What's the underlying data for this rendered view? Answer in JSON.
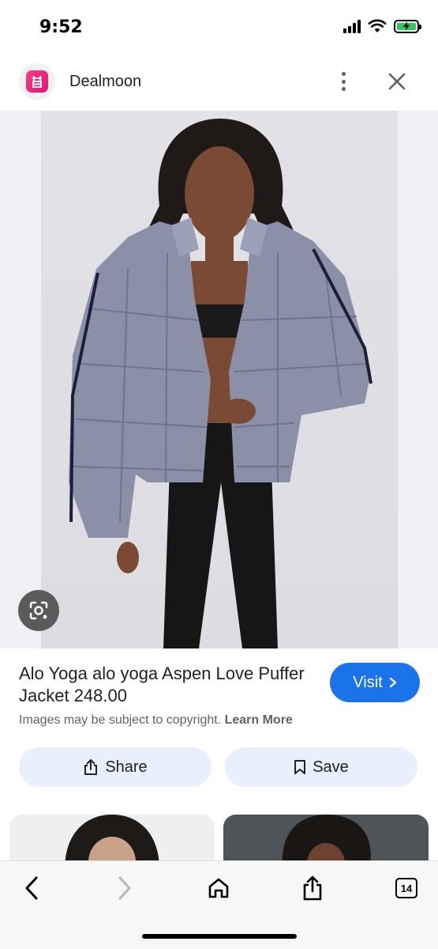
{
  "status_bar": {
    "time": "9:52"
  },
  "header": {
    "site_name": "Dealmoon",
    "logo_icon": "dealmoon-logo-icon",
    "logo_color": "#e0137b"
  },
  "product": {
    "title": "Alo Yoga alo yoga Aspen Love Puffer Jacket 248.00",
    "visit_label": "Visit",
    "copyright_text": "Images may be subject to copyright.",
    "learn_more_label": "Learn More"
  },
  "actions": {
    "share_label": "Share",
    "save_label": "Save"
  },
  "toolbar": {
    "tab_count": "14"
  },
  "colors": {
    "accent": "#1a73e8",
    "action_bg": "#e8f0fe",
    "jacket": "#8b8fa8"
  }
}
